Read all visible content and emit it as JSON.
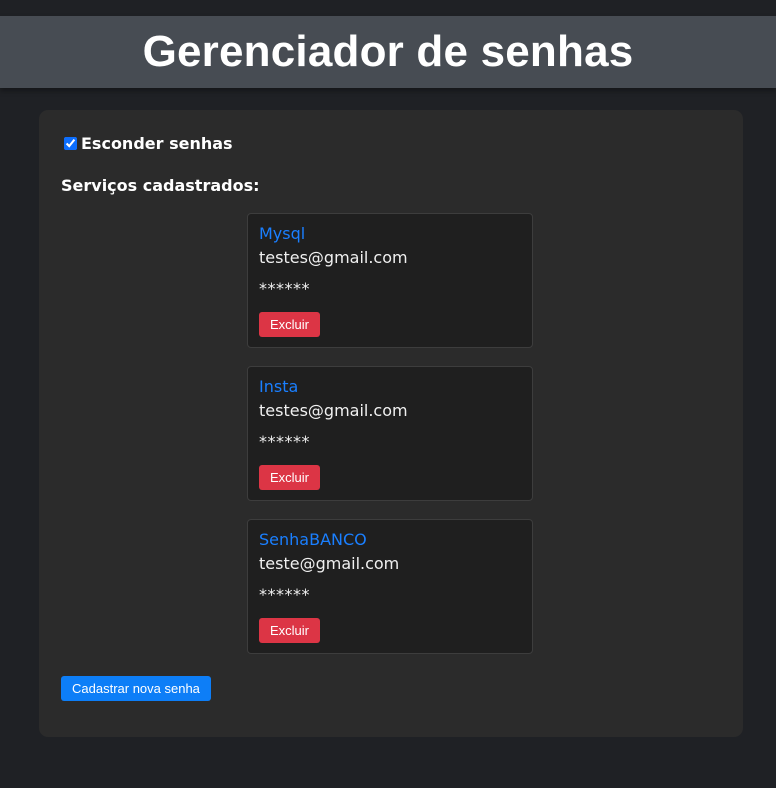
{
  "header": {
    "title": "Gerenciador de senhas"
  },
  "options": {
    "hide_passwords_label": "Esconder senhas",
    "hide_passwords_checked": true
  },
  "services_title": "Serviços cadastrados:",
  "services": [
    {
      "name": "Mysql",
      "email": "testes@gmail.com",
      "password": "******",
      "delete_label": "Excluir"
    },
    {
      "name": "Insta",
      "email": "testes@gmail.com",
      "password": "******",
      "delete_label": "Excluir"
    },
    {
      "name": "SenhaBANCO",
      "email": "teste@gmail.com",
      "password": "******",
      "delete_label": "Excluir"
    }
  ],
  "new_password_button": "Cadastrar nova senha",
  "colors": {
    "background": "#1f2125",
    "header": "#474c53",
    "panel": "#2b2b2b",
    "link": "#1a7fff",
    "danger": "#dc3545",
    "primary": "#0d7ef7"
  }
}
